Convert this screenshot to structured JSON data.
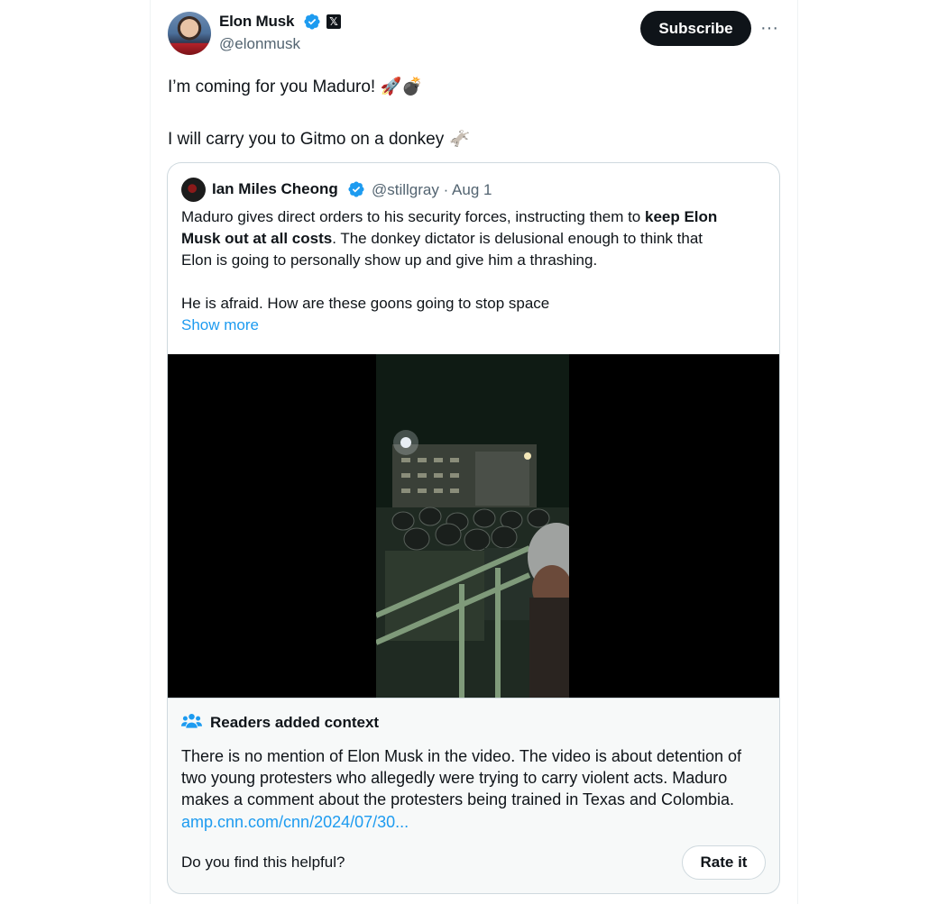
{
  "author": {
    "name": "Elon Musk",
    "handle": "@elonmusk",
    "x_badge": "𝕏"
  },
  "header": {
    "subscribe_label": "Subscribe",
    "more_label": "···"
  },
  "tweet": {
    "line1": "I’m coming for you Maduro! 🚀💣",
    "line2": "I will carry you to Gitmo on a donkey 🫏"
  },
  "quote": {
    "name": "Ian Miles Cheong",
    "handle_date": "@stillgray · Aug 1",
    "line1_pre": "Maduro gives direct orders to his security forces, instructing them to ",
    "line1_bold": "keep Elon",
    "line2_bold": "Musk out at all costs",
    "line2_post": ". The donkey dictator is delusional enough to think that",
    "line3": "Elon is going to personally show up and give him a thrashing.",
    "line4": "He is afraid. How are these goons going to stop space",
    "show_more": "Show more"
  },
  "context": {
    "title": "Readers added context",
    "line1": "There is no mention of Elon Musk in the video. The video is about detention of",
    "line2": "two young protesters who allegedly were trying to carry violent acts. Maduro",
    "line3": "makes a comment about the protesters being trained in Texas and Colombia.",
    "link": "amp.cnn.com/cnn/2024/07/30...",
    "helpful_question": "Do you find this helpful?",
    "rate_label": "Rate it"
  },
  "colors": {
    "accent": "#1d9bf0",
    "text": "#0f1419",
    "muted": "#536471",
    "border": "#cfd9de"
  }
}
